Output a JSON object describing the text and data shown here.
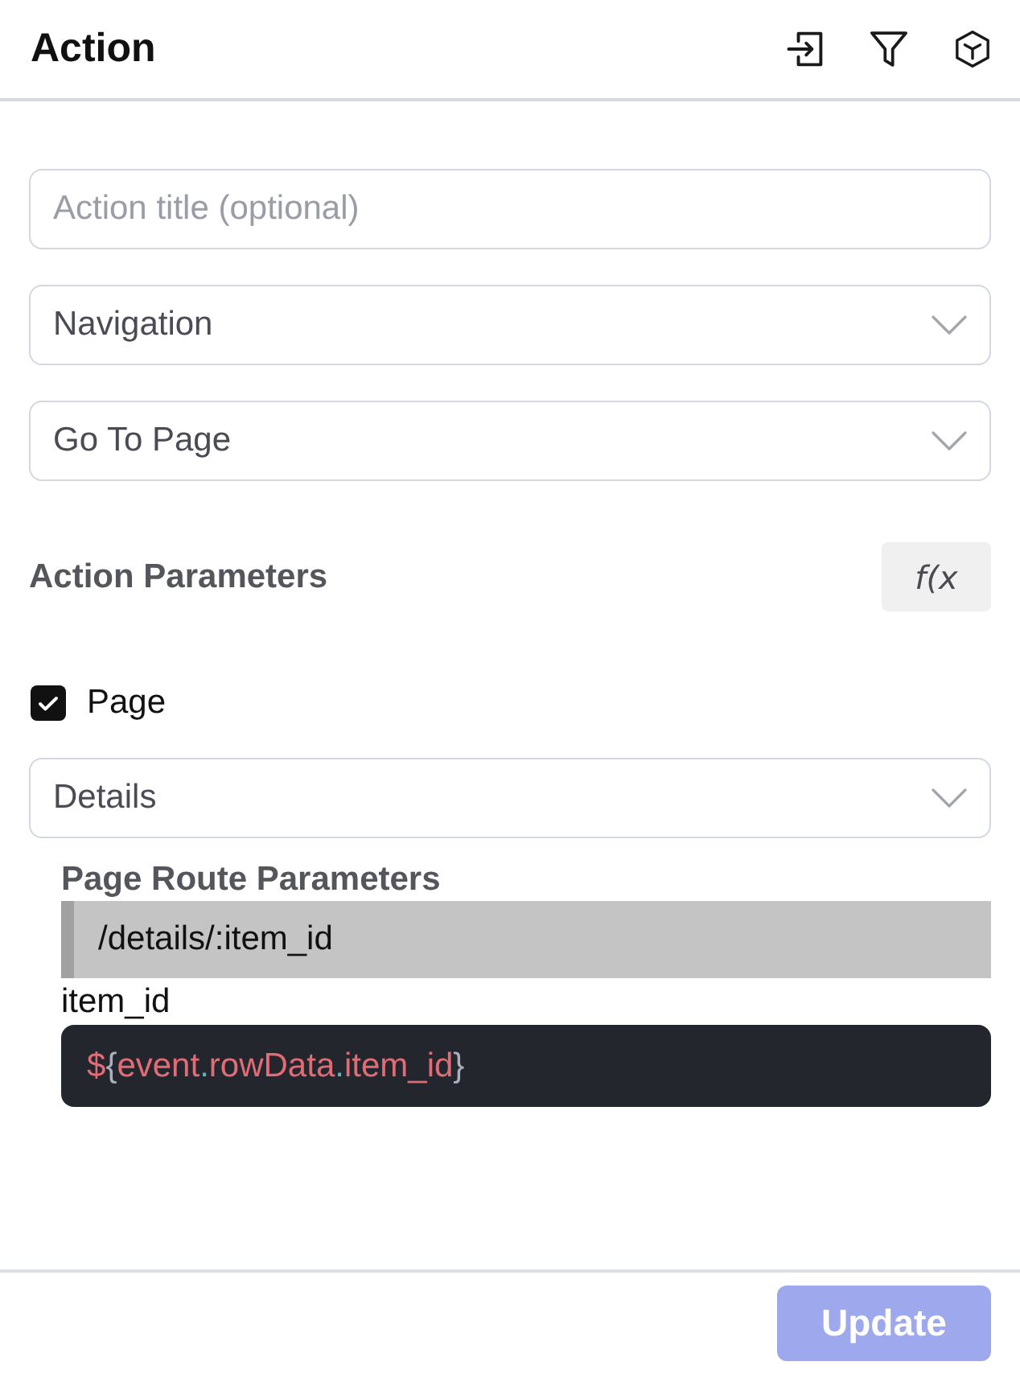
{
  "header": {
    "title": "Action"
  },
  "title_field": {
    "placeholder": "Action title (optional)"
  },
  "selects": [
    {
      "value": "Navigation"
    },
    {
      "value": "Go To Page"
    }
  ],
  "parameters": {
    "heading": "Action Parameters",
    "fx_button": "f(x",
    "page_checkbox": {
      "label": "Page",
      "checked": true
    },
    "page_select": {
      "value": "Details"
    },
    "route_heading": "Page Route Parameters",
    "route": "/details/:item_id",
    "params": [
      {
        "name": "item_id",
        "value": "${event.rowData.item_id}"
      }
    ]
  },
  "footer": {
    "button": {
      "label": "Update",
      "disabled": true
    }
  }
}
